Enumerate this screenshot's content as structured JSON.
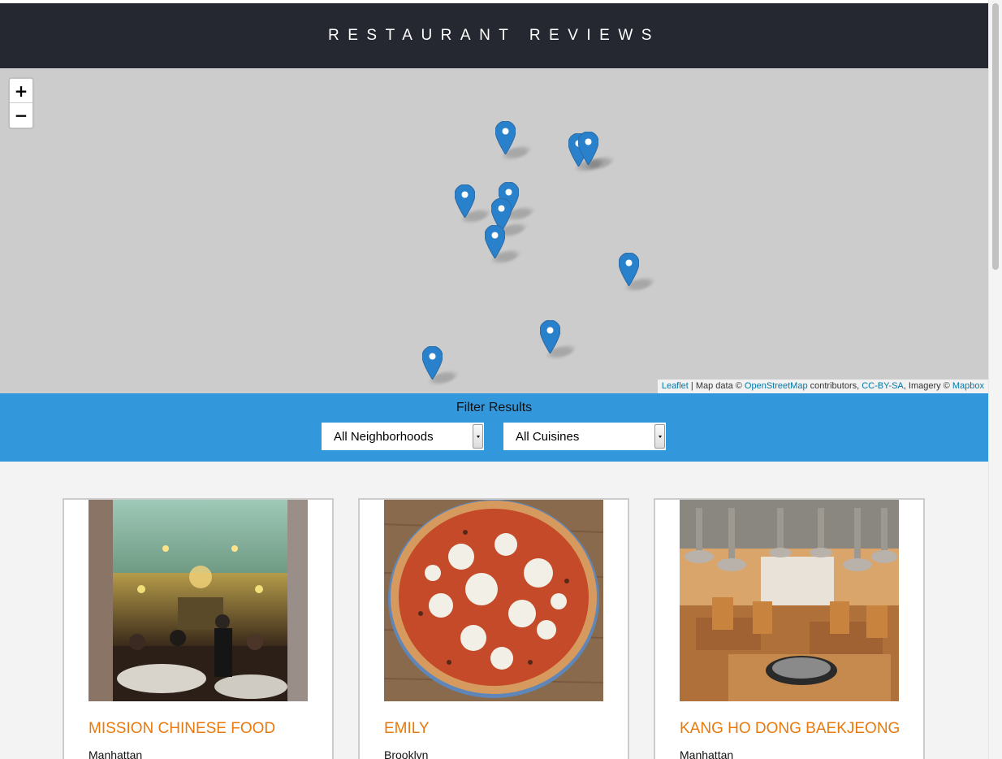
{
  "header": {
    "title": "RESTAURANT REVIEWS"
  },
  "map": {
    "zoom_in": "+",
    "zoom_out": "−",
    "marker_color": "#2a81cb",
    "marker_count": 11,
    "attribution": {
      "leaflet": "Leaflet",
      "sep1": " | Map data © ",
      "osm": "OpenStreetMap",
      "sep2": " contributors, ",
      "license": "CC-BY-SA",
      "sep3": ", Imagery © ",
      "imagery": "Mapbox"
    }
  },
  "filter": {
    "title": "Filter Results",
    "neighborhood": "All Neighborhoods",
    "cuisine": "All Cuisines"
  },
  "colors": {
    "header_bg": "#252831",
    "filter_bg": "#3397db",
    "accent": "#e8790d"
  },
  "restaurants": [
    {
      "name": "MISSION CHINESE FOOD",
      "neighborhood": "Manhattan",
      "image": "restaurant-dining-room-photo"
    },
    {
      "name": "EMILY",
      "neighborhood": "Brooklyn",
      "image": "margherita-pizza-photo"
    },
    {
      "name": "KANG HO DONG BAEKJEONG",
      "neighborhood": "Manhattan",
      "image": "korean-bbq-interior-photo"
    }
  ]
}
